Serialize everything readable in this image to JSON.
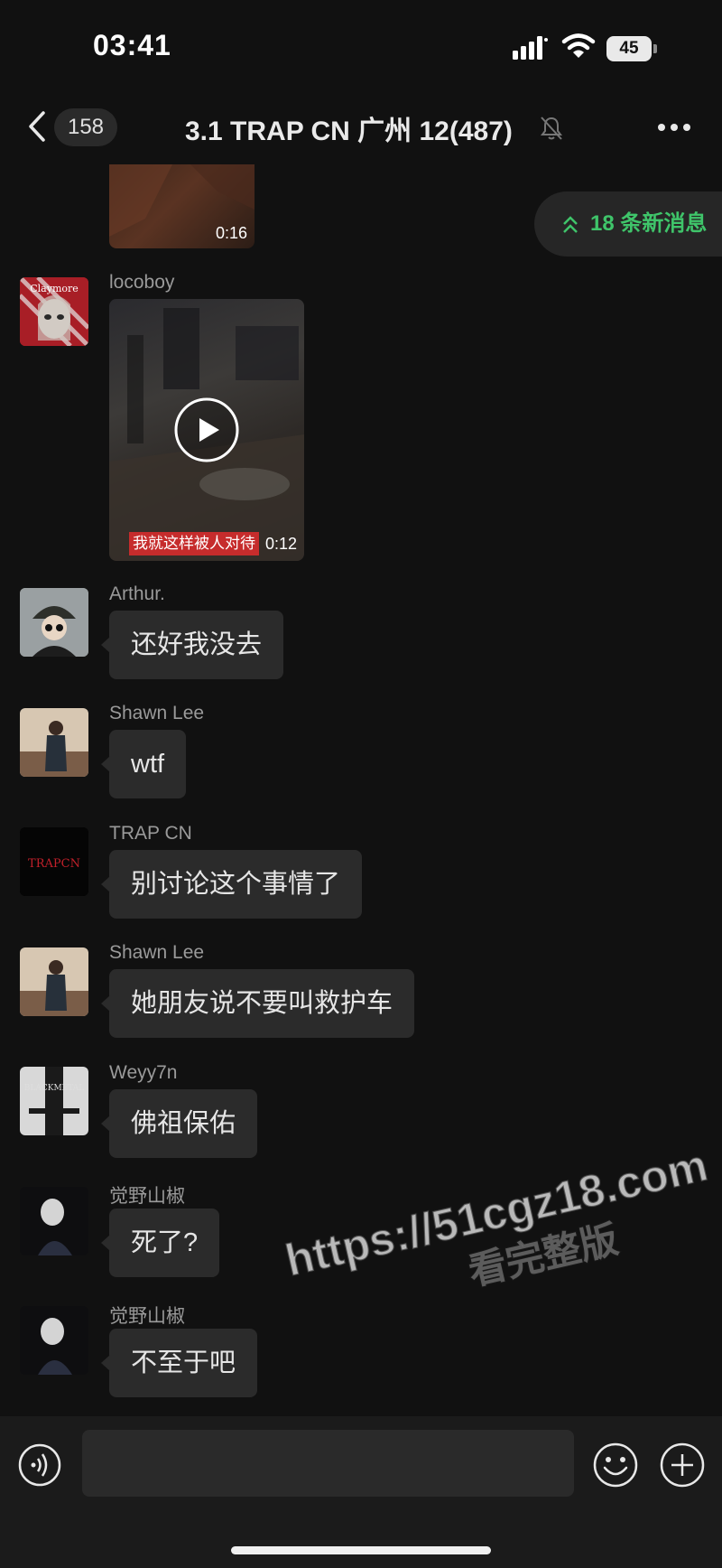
{
  "status_bar": {
    "time": "03:41",
    "battery": "45"
  },
  "header": {
    "back_count": "158",
    "title": "3.1 TRAP CN 广州 12(487)"
  },
  "new_messages": {
    "label": "18 条新消息"
  },
  "videos": {
    "top_duration": "0:16",
    "main_caption": "我就这样被人对待",
    "main_duration": "0:12"
  },
  "messages": [
    {
      "sender": "locoboy",
      "type": "video"
    },
    {
      "sender": "Arthur.",
      "text": "还好我没去"
    },
    {
      "sender": "Shawn Lee",
      "text": "wtf"
    },
    {
      "sender": "TRAP CN",
      "text": "别讨论这个事情了"
    },
    {
      "sender": "Shawn Lee",
      "text": "她朋友说不要叫救护车"
    },
    {
      "sender": "Weyy7n",
      "text": "佛祖保佑"
    },
    {
      "sender": "觉野山椒",
      "text": "死了?"
    },
    {
      "sender": "觉野山椒",
      "text": "不至于吧"
    }
  ],
  "watermark": {
    "line1": "https://51cgz18.com",
    "line2": "看完整版"
  },
  "avatar_text": {
    "locoboy": "Claymore",
    "trap": "TRAPCN",
    "weyy": "BLACKMETAL"
  },
  "icons": [
    "back-icon",
    "mute-icon",
    "more-icon",
    "double-chevron-up-icon",
    "play-icon",
    "voice-icon",
    "emoji-icon",
    "plus-icon"
  ],
  "colors": {
    "background": "#111111",
    "bubble": "#2b2b2b",
    "accent_green": "#3fc46a",
    "input_bar": "#1b1b1b"
  }
}
